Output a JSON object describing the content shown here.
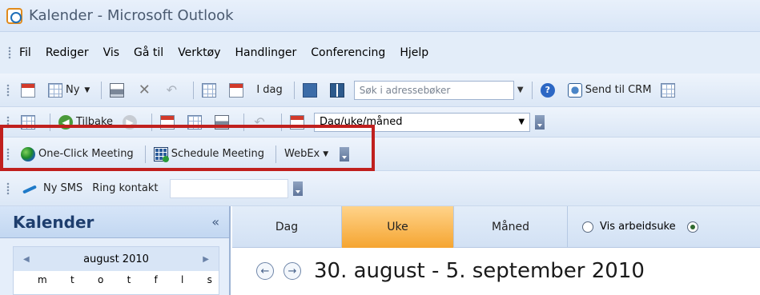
{
  "window": {
    "title": "Kalender - Microsoft Outlook"
  },
  "menubar": {
    "items": [
      "Fil",
      "Rediger",
      "Vis",
      "Gå til",
      "Verktøy",
      "Handlinger",
      "Conferencing",
      "Hjelp"
    ]
  },
  "toolbar_standard": {
    "new_label": "Ny",
    "today_label": "I dag",
    "search_placeholder": "Søk i adressebøker",
    "crm_label": "Send til CRM"
  },
  "toolbar_nav": {
    "back_label": "Tilbake",
    "view_value": "Dag/uke/måned"
  },
  "toolbar_webex": {
    "one_click_label": "One-Click Meeting",
    "schedule_label": "Schedule Meeting",
    "webex_label": "WebEx"
  },
  "toolbar_sms": {
    "new_sms_label": "Ny SMS",
    "call_label": "Ring kontakt"
  },
  "navigation_pane": {
    "title": "Kalender",
    "collapse_glyph": "«",
    "mini_calendar": {
      "month": "august 2010",
      "weekdays": [
        "m",
        "t",
        "o",
        "t",
        "f",
        "l",
        "s"
      ]
    }
  },
  "calendar_view": {
    "tabs": [
      "Dag",
      "Uke",
      "Måned"
    ],
    "active_tab": "Uke",
    "workweek_option": "Vis arbeidsuke",
    "date_range": "30. august - 5. september 2010"
  },
  "colors": {
    "highlight_border": "#c0201e",
    "active_tab": "#f5a531",
    "accent": "#1e3e6e"
  }
}
